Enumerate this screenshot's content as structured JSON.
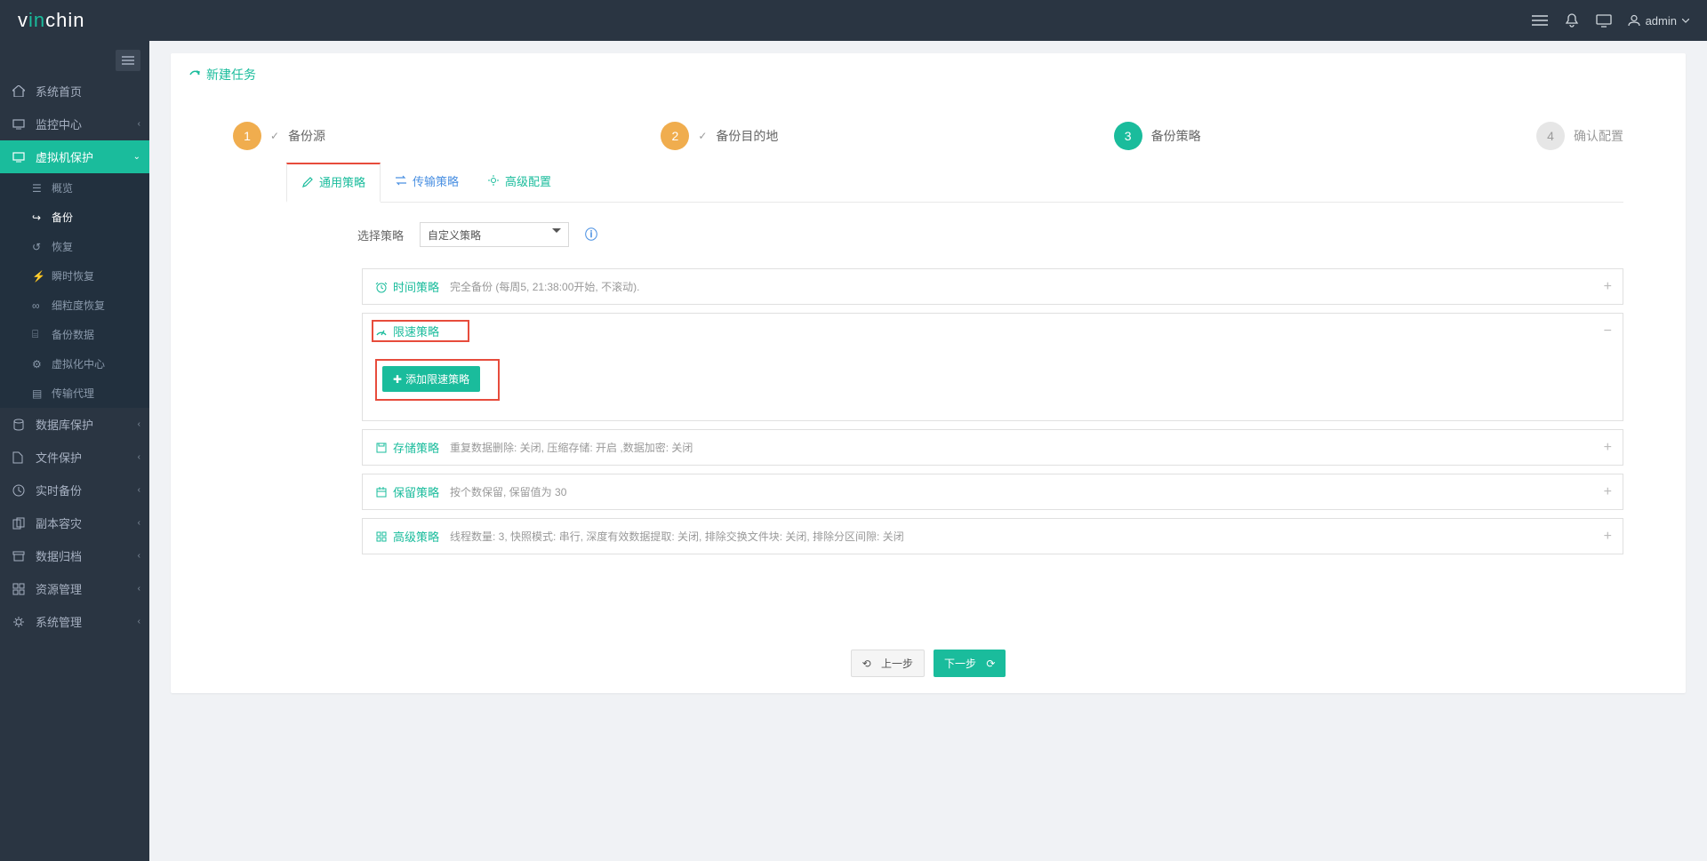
{
  "header": {
    "logo_v": "v",
    "logo_in": "in",
    "logo_chin": "chin",
    "user": "admin"
  },
  "sidebar": {
    "items": [
      {
        "icon": "home",
        "label": "系统首页"
      },
      {
        "icon": "monitor",
        "label": "监控中心",
        "chev": true
      },
      {
        "icon": "display",
        "label": "虚拟机保护",
        "active": true,
        "chev": true
      },
      {
        "icon": "db",
        "label": "数据库保护",
        "chev": true
      },
      {
        "icon": "file",
        "label": "文件保护",
        "chev": true
      },
      {
        "icon": "clock",
        "label": "实时备份",
        "chev": true
      },
      {
        "icon": "copy",
        "label": "副本容灾",
        "chev": true
      },
      {
        "icon": "archive",
        "label": "数据归档",
        "chev": true
      },
      {
        "icon": "grid",
        "label": "资源管理",
        "chev": true
      },
      {
        "icon": "gear",
        "label": "系统管理",
        "chev": true
      }
    ],
    "sub": [
      {
        "label": "概览"
      },
      {
        "label": "备份",
        "active": true
      },
      {
        "label": "恢复"
      },
      {
        "label": "瞬时恢复"
      },
      {
        "label": "细粒度恢复"
      },
      {
        "label": "备份数据"
      },
      {
        "label": "虚拟化中心"
      },
      {
        "label": "传输代理"
      }
    ]
  },
  "page": {
    "title": "新建任务"
  },
  "wizard": {
    "steps": [
      {
        "num": "1",
        "label": "备份源",
        "state": "done",
        "check": true
      },
      {
        "num": "2",
        "label": "备份目的地",
        "state": "done",
        "check": true
      },
      {
        "num": "3",
        "label": "备份策略",
        "state": "cur"
      },
      {
        "num": "4",
        "label": "确认配置",
        "state": "todo"
      }
    ]
  },
  "tabs": [
    {
      "label": "通用策略",
      "active": true
    },
    {
      "label": "传输策略"
    },
    {
      "label": "高级配置"
    }
  ],
  "form": {
    "select_label": "选择策略",
    "select_value": "自定义策略"
  },
  "acc": {
    "time": {
      "title": "时间策略",
      "desc": "完全备份 (每周5, 21:38:00开始, 不滚动)."
    },
    "speed": {
      "title": "限速策略",
      "button": "添加限速策略"
    },
    "storage": {
      "title": "存储策略",
      "desc": "重复数据删除: 关闭, 压缩存储: 开启 ,数据加密: 关闭"
    },
    "retain": {
      "title": "保留策略",
      "desc": "按个数保留, 保留值为 30"
    },
    "adv": {
      "title": "高级策略",
      "desc": "线程数量: 3, 快照模式: 串行, 深度有效数据提取: 关闭, 排除交换文件块: 关闭, 排除分区间隙: 关闭"
    }
  },
  "buttons": {
    "prev": "上一步",
    "next": "下一步"
  }
}
